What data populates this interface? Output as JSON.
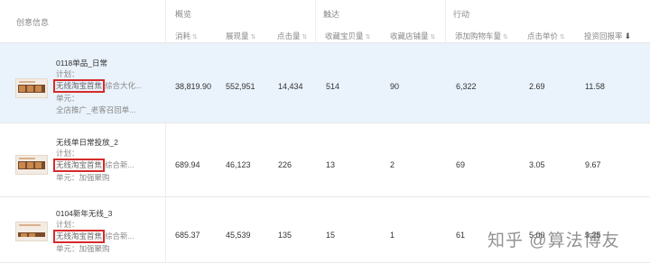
{
  "header": {
    "creative_label": "创意信息",
    "groups": [
      "概览",
      "触达",
      "行动"
    ],
    "columns": [
      "消耗",
      "展现量",
      "点击量",
      "收藏宝贝量",
      "收藏店铺量",
      "添加购物车量",
      "点击单价",
      "投资回报率"
    ],
    "sort_icon": "⇅",
    "sort_active_icon": "⬇"
  },
  "rows": [
    {
      "name": "0118单品_日常",
      "plan": "计划：",
      "tag": "无线淘宝首焦",
      "tag_rest": "综合大化...",
      "unit": "单元：",
      "unit_rest": "全店推广_老客召回单...",
      "values": [
        "38,819.90",
        "552,951",
        "14,434",
        "514",
        "90",
        "6,322",
        "2.69",
        "11.58"
      ]
    },
    {
      "name": "无线单日常投放_2",
      "plan": "计划：",
      "tag": "无线淘宝首焦",
      "tag_rest": "综合新...",
      "unit": "单元：加强聚购",
      "values": [
        "689.94",
        "46,123",
        "226",
        "13",
        "2",
        "69",
        "3.05",
        "9.67"
      ]
    },
    {
      "name": "0104新年无线_3",
      "plan": "计划：",
      "tag": "无线淘宝首焦",
      "tag_rest": "综合新...",
      "unit": "单元：加强聚购",
      "values": [
        "685.37",
        "45,539",
        "135",
        "15",
        "1",
        "61",
        "5.00",
        "9.25"
      ]
    }
  ],
  "watermark": "知乎 @算法博友"
}
